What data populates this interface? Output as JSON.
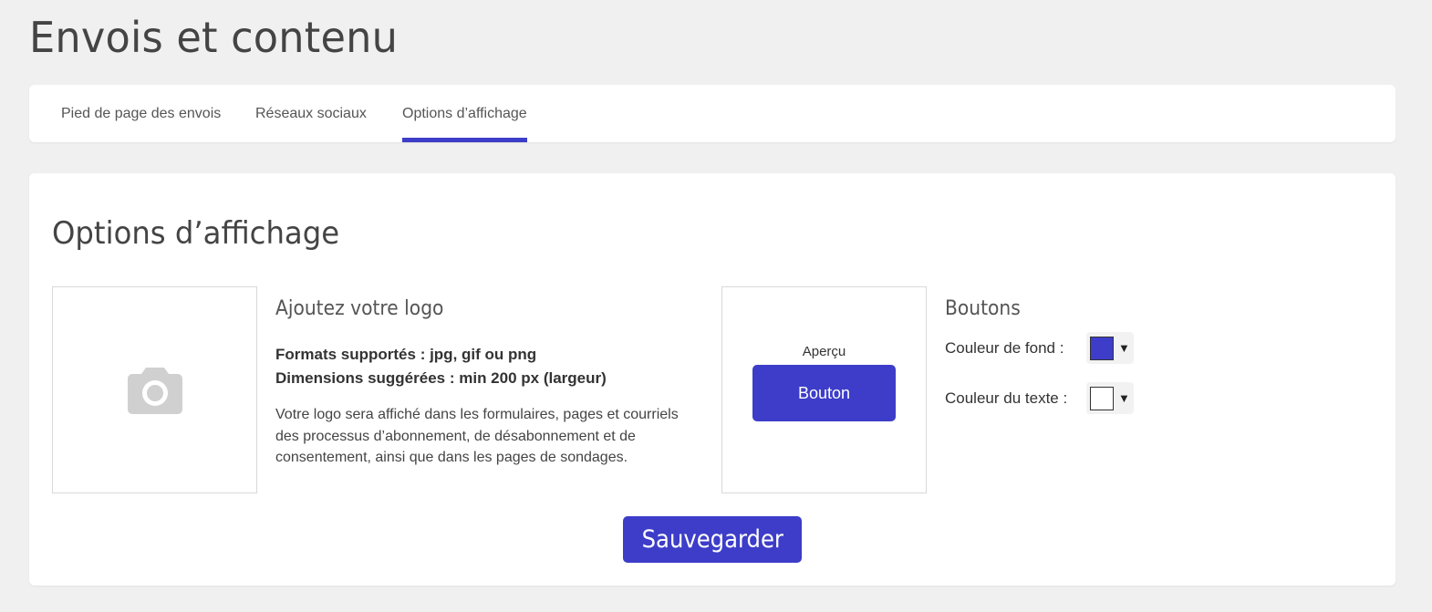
{
  "page": {
    "title": "Envois et contenu"
  },
  "tabs": [
    {
      "label": "Pied de page des envois",
      "active": false
    },
    {
      "label": "Réseaux sociaux",
      "active": false
    },
    {
      "label": "Options d’affichage",
      "active": true
    }
  ],
  "main": {
    "title": "Options d’affichage",
    "logo": {
      "icon": "camera-icon",
      "heading": "Ajoutez votre logo",
      "formats": "Formats supportés : jpg, gif ou png",
      "dimensions": "Dimensions suggérées : min 200 px (largeur)",
      "description": "Votre logo sera affiché dans les formulaires, pages et courriels des processus d’abonnement, de désabonnement et de consentement, ainsi que dans les pages de sondages."
    },
    "preview": {
      "label": "Aperçu",
      "button_label": "Bouton"
    },
    "buttons": {
      "heading": "Boutons",
      "background_color_label": "Couleur de fond :",
      "background_color": "#3d3dc9",
      "text_color_label": "Couleur du texte :",
      "text_color": "#ffffff"
    },
    "save_label": "Sauvegarder"
  },
  "colors": {
    "accent": "#3d3dc9",
    "background": "#f0f0f0"
  }
}
